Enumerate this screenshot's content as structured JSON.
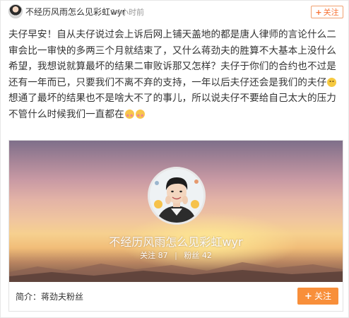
{
  "header": {
    "username": "不经历风雨怎么见彩虹wyr",
    "timestamp": "14小时前",
    "follow_label": "关注",
    "follow_icon": "plus-icon"
  },
  "post": {
    "text_part1": "夫仔早安！自从夫仔说过会上诉后网上铺天盖地的都是唐人律师的言论什么二审会比一审快的多两三个月就结束了，又什么蒋劲夫的胜算不大基本上没什么希望，我想说就算最坏的结果二审败诉那又怎样？夫仔于你们的合约也不过是还有一年而已，只要我们不离不弃的支持，一年以后夫仔还会是我们的夫仔",
    "text_part2": "想通了最坏的结果也不是啥大不了的事儿，所以说夫仔不要给自己太大的压力不管什么时候我们一直都在",
    "emoji_1": "smile-emoji",
    "emoji_2": "blush-emoji"
  },
  "card": {
    "name": "不经历风雨怎么见彩虹wyr",
    "following_label": "关注",
    "following_count": "87",
    "followers_label": "粉丝",
    "followers_count": "42",
    "intro": "简介：蒋劲夫粉丝",
    "follow_label": "关注",
    "accent": "#f88f3a"
  }
}
